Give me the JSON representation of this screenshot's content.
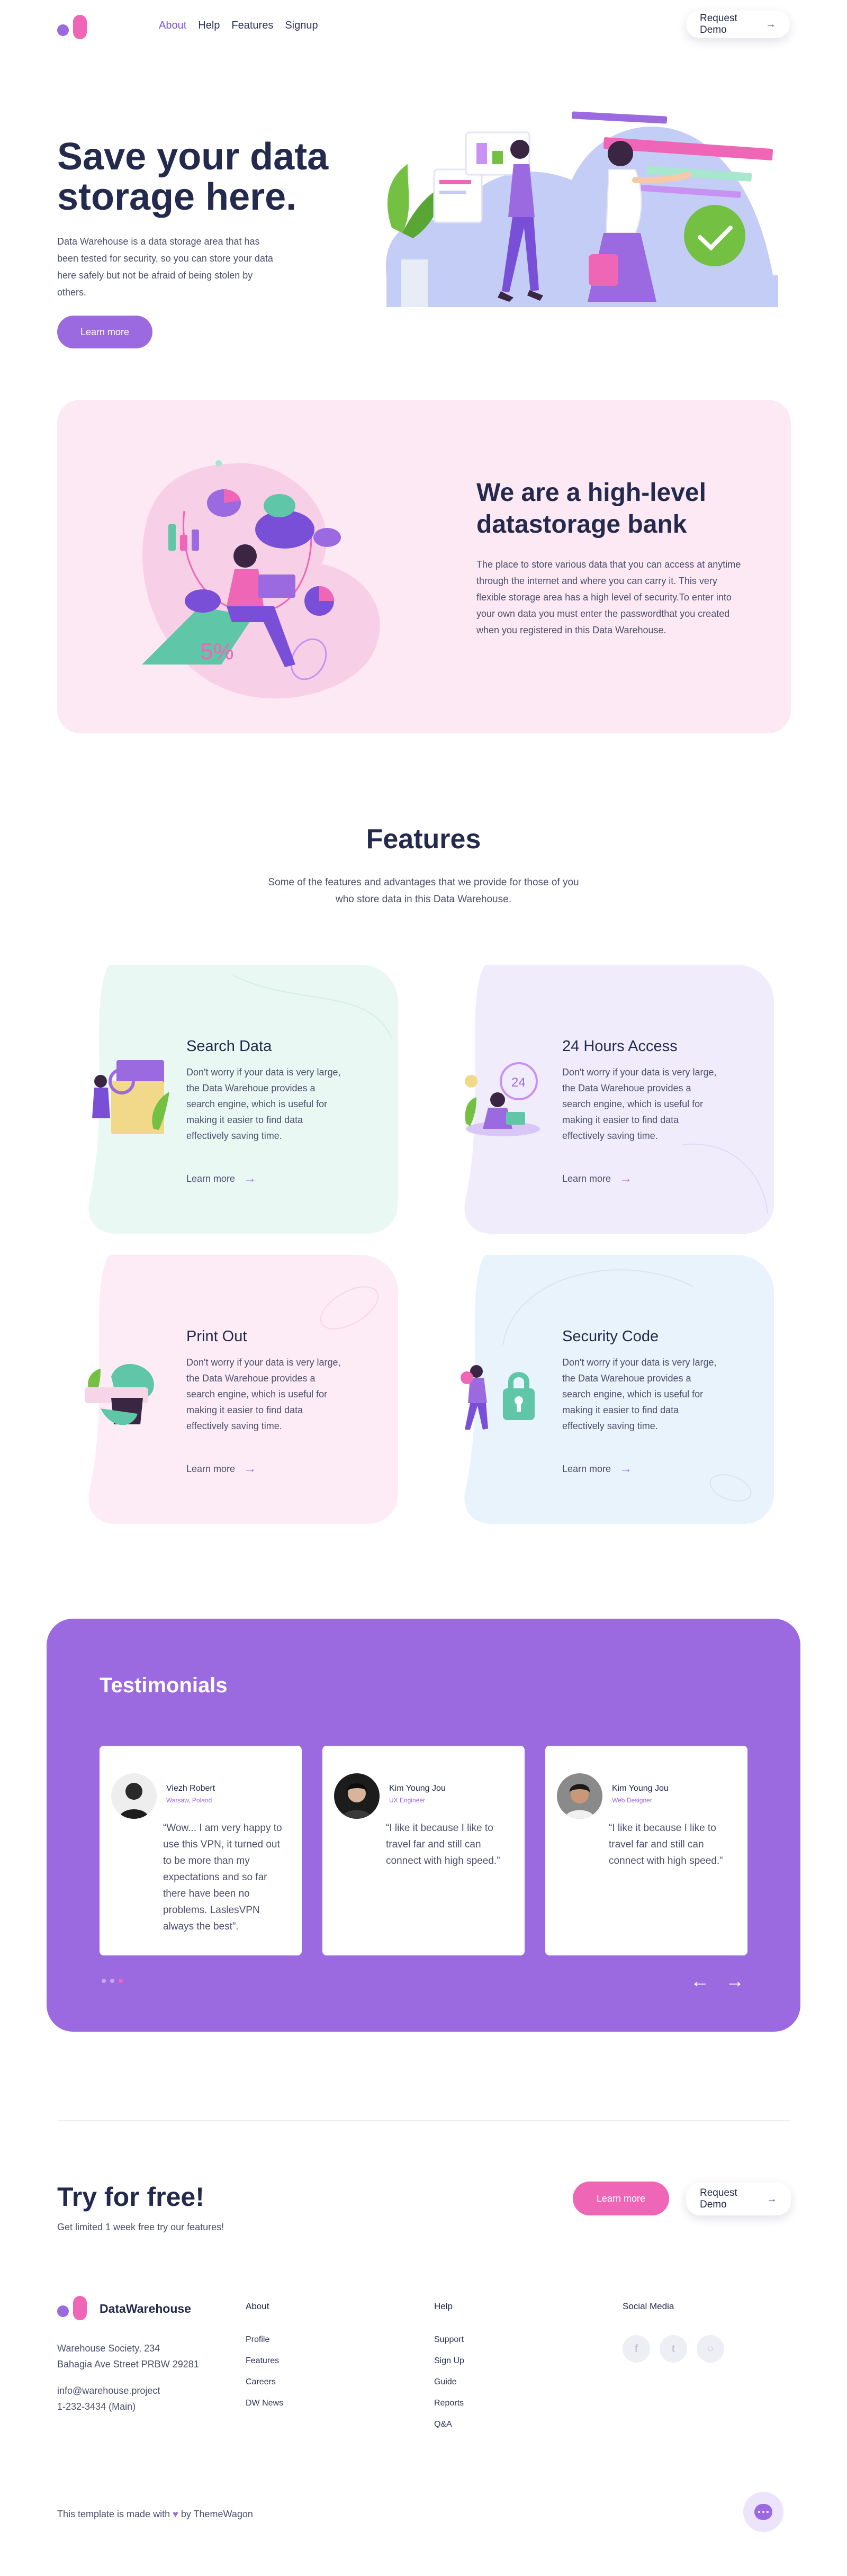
{
  "nav": {
    "links": [
      {
        "label": "About",
        "active": true
      },
      {
        "label": "Help"
      },
      {
        "label": "Features"
      },
      {
        "label": "Signup"
      }
    ],
    "demo_label": "Request Demo",
    "demo_arrow_icon": "arrow-right-icon"
  },
  "hero": {
    "title": "Save your data storage here.",
    "text": "Data Warehouse is a data storage area that has been tested for security, so you can store your data here safely but not be afraid of being stolen by others.",
    "button": "Learn more"
  },
  "bank": {
    "title": "We are a high-level datastorage bank",
    "text": "The place to store various data that you can access at anytime through the internet and where you can carry it. This very flexible storage area has a high level of security.To enter into your own data you must enter the passwordthat you created when you registered in this Data Warehouse.",
    "illus_label": "5%"
  },
  "features": {
    "title": "Features",
    "subtitle": "Some of the features and advantages that we provide for those of you who store data in this Data Warehouse.",
    "cards": [
      {
        "title": "Search Data",
        "text": "Don't worry if your data is very large, the Data Warehoue provides a search engine, which is useful for making it easier to find data effectively saving time.",
        "link": "Learn more",
        "bg": "#eaf8f4"
      },
      {
        "title": "24 Hours Access",
        "text": "Don't worry if your data is very large, the Data Warehoue provides a search engine, which is useful for making it easier to find data effectively saving time.",
        "link": "Learn more",
        "bg": "#f1ecfc",
        "illus_label": "24"
      },
      {
        "title": "Print Out",
        "text": "Don't worry if your data is very large, the Data Warehoue provides a search engine, which is useful for making it easier to find data effectively saving time.",
        "link": "Learn more",
        "bg": "#fdecf5"
      },
      {
        "title": "Security Code",
        "text": "Don't worry if your data is very large, the Data Warehoue provides a search engine, which is useful for making it easier to find data effectively saving time.",
        "link": "Learn more",
        "bg": "#e8f3fb"
      }
    ]
  },
  "testimonials": {
    "title": "Testimonials",
    "items": [
      {
        "name": "Viezh Robert",
        "role": "Warsaw, Poland",
        "quote": "“Wow... I am very happy to use this VPN, it turned out to be more than my expectations and so far there have been no problems. LaslesVPN always the best”."
      },
      {
        "name": "Kim Young Jou",
        "role": "UX Engineer",
        "quote": "“I like it because I like to travel far and still can connect with high speed.”"
      },
      {
        "name": "Kim Young Jou",
        "role": "Web Designer",
        "quote": "“I like it because I like to travel far and still can connect with high speed.”"
      }
    ],
    "prev_icon": "arrow-left-icon",
    "next_icon": "arrow-right-icon"
  },
  "cta": {
    "title": "Try for free!",
    "subtitle": "Get limited 1 week free try our features!",
    "learn_label": "Learn more",
    "demo_label": "Request Demo"
  },
  "footer": {
    "brand": "DataWarehouse",
    "address_line1": "Warehouse Society, 234",
    "address_line2": "Bahagia Ave Street PRBW 29281",
    "email": "info@warehouse.project",
    "phone": "1-232-3434 (Main)",
    "about_head": "About",
    "about_links": [
      "Profile",
      "Features",
      "Careers",
      "DW News"
    ],
    "help_head": "Help",
    "help_links": [
      "Support",
      "Sign Up",
      "Guide",
      "Reports",
      "Q&A"
    ],
    "social_head": "Social Media",
    "socials": [
      {
        "icon": "facebook-icon",
        "glyph": "f"
      },
      {
        "icon": "twitter-icon",
        "glyph": "t"
      },
      {
        "icon": "instagram-icon",
        "glyph": "○"
      }
    ],
    "made_prefix": "This template is made with",
    "made_suffix": "by ThemeWagon"
  },
  "colors": {
    "accent": "#9b6ae0",
    "pink": "#f066b6",
    "dark": "#232a4d"
  }
}
